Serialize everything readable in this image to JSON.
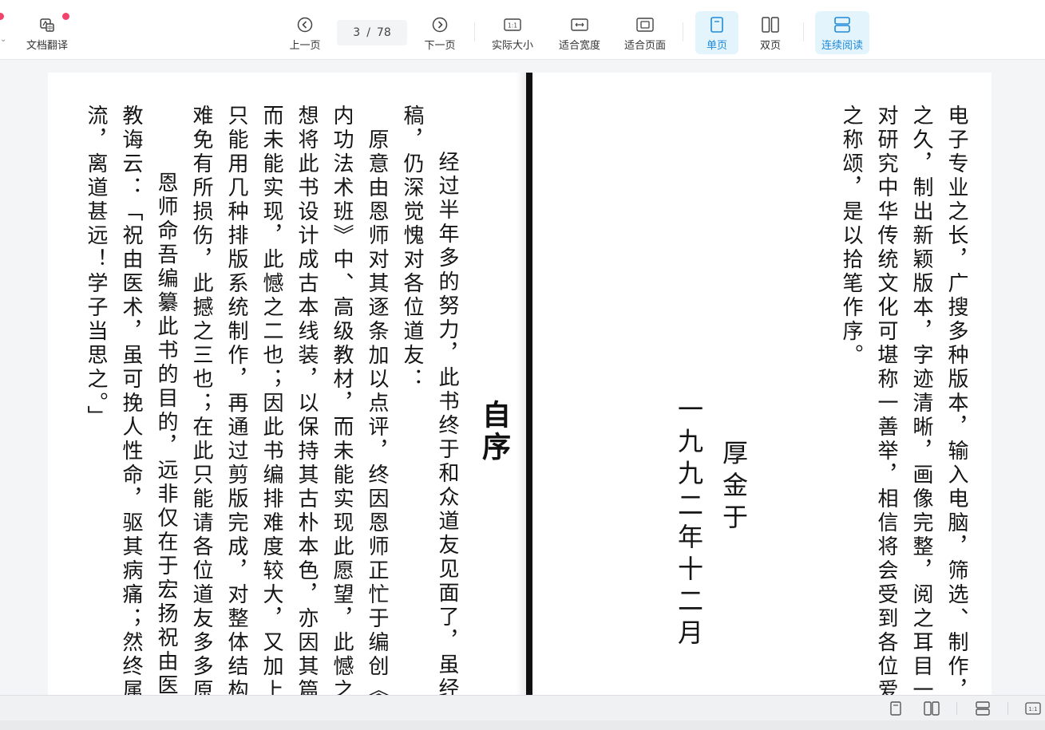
{
  "toolbar": {
    "translate_label": "文档翻译",
    "prev_label": "上一页",
    "page_current": "3",
    "page_sep": "/",
    "page_total": "78",
    "next_label": "下一页",
    "actual_size_label": "实际大小",
    "fit_width_label": "适合宽度",
    "fit_page_label": "适合页面",
    "single_label": "单页",
    "double_label": "双页",
    "continuous_label": "连续阅读"
  },
  "icons": {
    "translate": "translate-icon",
    "prev": "chevron-left-circle-icon",
    "next": "chevron-right-circle-icon",
    "actual_size_text": "1:1",
    "fit_width": "fit-width-icon",
    "fit_page": "fit-page-icon",
    "single": "single-page-icon",
    "double": "double-page-icon",
    "continuous": "continuous-icon"
  },
  "colors": {
    "accent": "#1f8ad8",
    "active_bg": "#e4f4fd",
    "dot": "#f2436b"
  },
  "document": {
    "left_page": {
      "title": "自序",
      "columns": [
        "经过半年多的努力，此书终于和众道友见面了，虽经三",
        "稿，仍深觉愧对各位道友：",
        "　原意由恩师对其逐条加以点评，终因恩师正忙于编创《",
        "内功法术班》中、高级教材，而未能实现此愿望，此憾之一；",
        "想将此书设计成古本线装，以保持其古朴本色，亦因其篇幅",
        "而未能实现，此憾之二也；因此书编排难度较大，又加上是",
        "只能用几种排版系统制作，再通过剪版完成，对整体结构的",
        "难免有所损伤，此撼之三也；在此只能请各位道友多多原谅",
        "　恩师命吾编纂此书的目的，远非仅在于宏扬祝由医术，",
        "教诲云：「祝由医术，虽可挽人性命，驱其病痛；然终属术",
        "流，离道甚远！学子当思之。」"
      ]
    },
    "right_page": {
      "columns": [
        "电子专业之长，广搜多种版本，输入电脑，筛选、制作，伏案",
        "之久，制出新颖版本，字迹清晰，画像完整，阅之耳目一新。",
        "对研究中华传统文化可堪称一善举，相信将会受到各位爱",
        "之称颂，是以拾笔作序。"
      ],
      "signature": "厚金于",
      "date": "一九九二年十二月"
    }
  },
  "statusbar": {
    "single": "single-page-icon",
    "double": "double-page-icon",
    "continuous": "continuous-icon",
    "actual_text": "1:1"
  }
}
